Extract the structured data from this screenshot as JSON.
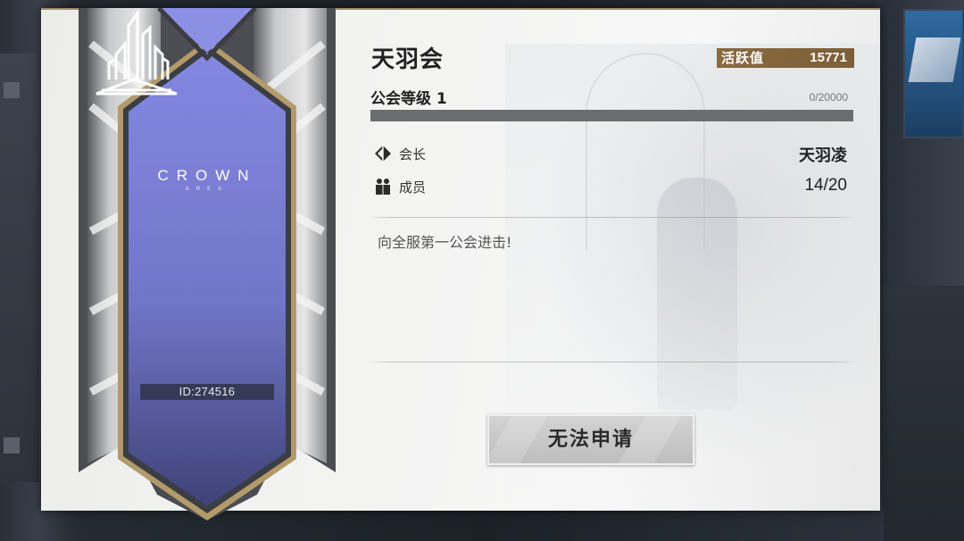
{
  "guild": {
    "name": "天羽会",
    "id": "ID:274516",
    "logo_text": "CROWN",
    "logo_subtext": "AREA",
    "activity_label": "活跃值",
    "activity_value": "15771",
    "level_label": "公会等级 1",
    "level_progress": "0/20000",
    "level_progress_fraction": 0,
    "leader_label": "会长",
    "leader_name": "天羽凌",
    "members_label": "成员",
    "members_value": "14/20",
    "slogan": "向全服第一公会进击!"
  },
  "actions": {
    "apply_label": "无法申请"
  },
  "icons": {
    "leader": "diamond-emblem-icon",
    "members": "members-icon"
  },
  "colors": {
    "banner_purple": "#7b7fd6",
    "activity_bg": "#8a6a3f",
    "level_bar": "#6b6d70"
  }
}
